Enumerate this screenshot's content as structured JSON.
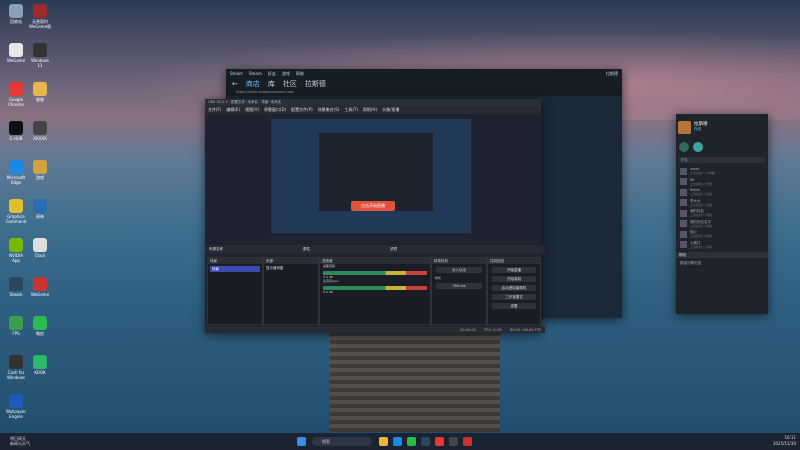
{
  "desktop": {
    "icons": [
      {
        "label": "回收站",
        "color": "#8aa0b8"
      },
      {
        "label": "无畏契约\nWeGame版",
        "color": "#9c2b30"
      },
      {
        "label": "WeGame",
        "color": "#e8e8e8"
      },
      {
        "label": "Windows\n11",
        "color": "#333"
      },
      {
        "label": "Google\nChrome",
        "color": "#e53935"
      },
      {
        "label": "猫猫",
        "color": "#e6b84a"
      },
      {
        "label": "G HUB",
        "color": "#111"
      },
      {
        "label": "XXXXX",
        "color": "#444"
      },
      {
        "label": "Microsoft\nEdge",
        "color": "#1e88e5"
      },
      {
        "label": "游戏",
        "color": "#d4a340"
      },
      {
        "label": "Graphics\nCommand",
        "color": "#e0c030"
      },
      {
        "label": "原神",
        "color": "#2a6cb0"
      },
      {
        "label": "NVIDIA\nApp",
        "color": "#76b900"
      },
      {
        "label": "Clock",
        "color": "#ddd"
      },
      {
        "label": "Steam",
        "color": "#2a475e"
      },
      {
        "label": "WeGame",
        "color": "#c33"
      },
      {
        "label": "FPS",
        "color": "#3c9c4c"
      },
      {
        "label": "微信",
        "color": "#2dbb4e"
      },
      {
        "label": "Cash for\nWindows",
        "color": "#333"
      },
      {
        "label": "KOOK",
        "color": "#2db96b"
      },
      {
        "label": "Wallpaper\nEngine",
        "color": "#1e5bb8"
      }
    ]
  },
  "steam": {
    "title": "Steam",
    "menu": [
      "Steam",
      "查看",
      "好友",
      "游戏",
      "帮助"
    ],
    "tabs": [
      "商店",
      "库",
      "社区",
      "拉斯德"
    ],
    "url": "https://store.steampowered.com/",
    "user": "拉斯德"
  },
  "obs": {
    "title": "OBS 30.2.3 - 配置文件: 未命名 - 场景: 未命名",
    "menu": [
      "文件(F)",
      "编辑(E)",
      "视图(V)",
      "停靠窗口(D)",
      "配置文件(P)",
      "场景集合(S)",
      "工具(T)",
      "帮助(H)",
      "头像/直播"
    ],
    "preview_button": "点击开始直播",
    "scene_bar": {
      "label": "来源名称",
      "props": "属性",
      "filters": "滤镜"
    },
    "docks": {
      "scenes": "场景",
      "sources": "来源",
      "mixer": "混音器",
      "transitions": "转场特效",
      "controls": "控制按钮"
    },
    "scene_item": "场景",
    "source_item": "显示器采集",
    "mixer_tracks": [
      {
        "name": "桌面音频",
        "level": "0.0 dB"
      },
      {
        "name": "麦克风/Aux",
        "level": "0.0 dB"
      }
    ],
    "transition": {
      "type": "淡入淡出",
      "duration_label": "时长",
      "duration": "300 ms"
    },
    "controls": [
      "开始直播",
      "开始录制",
      "启动虚拟摄像机",
      "工作室模式",
      "设置"
    ],
    "status": [
      "00:00:00",
      "CPU: 0.4%",
      "60.00 / 60.00 FPS"
    ]
  },
  "friends": {
    "user": "拉斯德",
    "status": "在线",
    "search": "好友",
    "groups": [
      "好友",
      "群组"
    ],
    "list": [
      {
        "name": "wood",
        "sub": "上次在线 1 小时前"
      },
      {
        "name": "Mr",
        "sub": "上次在线 2 天前"
      },
      {
        "name": "Ralph",
        "sub": "上次在线 3 天前"
      },
      {
        "name": "李大大",
        "sub": "上次在线 5 天前"
      },
      {
        "name": "我的好友",
        "sub": "上次在线 1 周前"
      },
      {
        "name": "我的好友名字",
        "sub": "上次在线 2 周前"
      },
      {
        "name": "烛火",
        "sub": "上次在线 3 周前"
      },
      {
        "name": "九尾灯",
        "sub": "上次在线 1 月前"
      }
    ],
    "group_item": "群组与聊天室"
  },
  "taskbar": {
    "news": "明日雨天\n新闻与天气",
    "search": "搜索",
    "time": "16:11",
    "date": "2025/11/30"
  }
}
